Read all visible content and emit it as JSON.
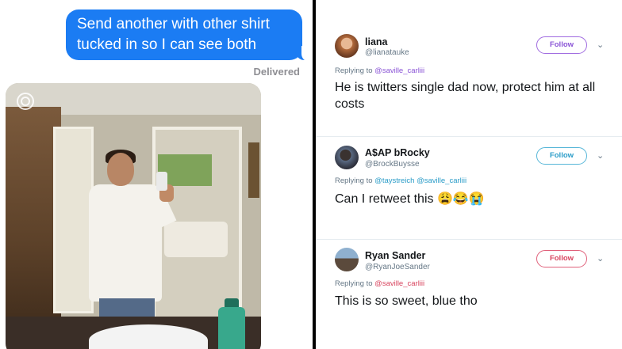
{
  "imessage": {
    "bubble_line1": "Send another with other shirt",
    "bubble_line2": "tucked in so I can see both",
    "status": "Delivered",
    "bubble_color": "#1b7cf3",
    "live_photo_icon": "live-photo-icon"
  },
  "twitter": {
    "follow_label": "Follow",
    "replying_prefix": "Replying to",
    "tweets": [
      {
        "name": "liana",
        "handle": "@lianatauke",
        "mentions": [
          "@saville_carliii"
        ],
        "text": "He is twitters single dad now, protect him at all costs",
        "accent": "#8a54d6"
      },
      {
        "name": "A$AP bRocky",
        "handle": "@BrockBuysse",
        "mentions": [
          "@taystreich",
          "@saville_carliii"
        ],
        "text": "Can I retweet this 😩😂😭",
        "accent": "#2a9cc8"
      },
      {
        "name": "Ryan Sander",
        "handle": "@RyanJoeSander",
        "mentions": [
          "@saville_carliii"
        ],
        "text": "This is so sweet, blue tho",
        "accent": "#d8455f"
      }
    ]
  }
}
